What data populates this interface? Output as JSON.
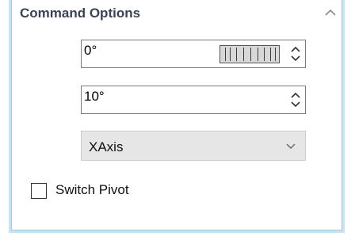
{
  "panel": {
    "title": "Command Options",
    "angle_input": {
      "value": "0°"
    },
    "step_input": {
      "value": "10°"
    },
    "axis_select": {
      "selected": "XAxis"
    },
    "switch_pivot": {
      "label": "Switch Pivot",
      "checked": false
    }
  }
}
